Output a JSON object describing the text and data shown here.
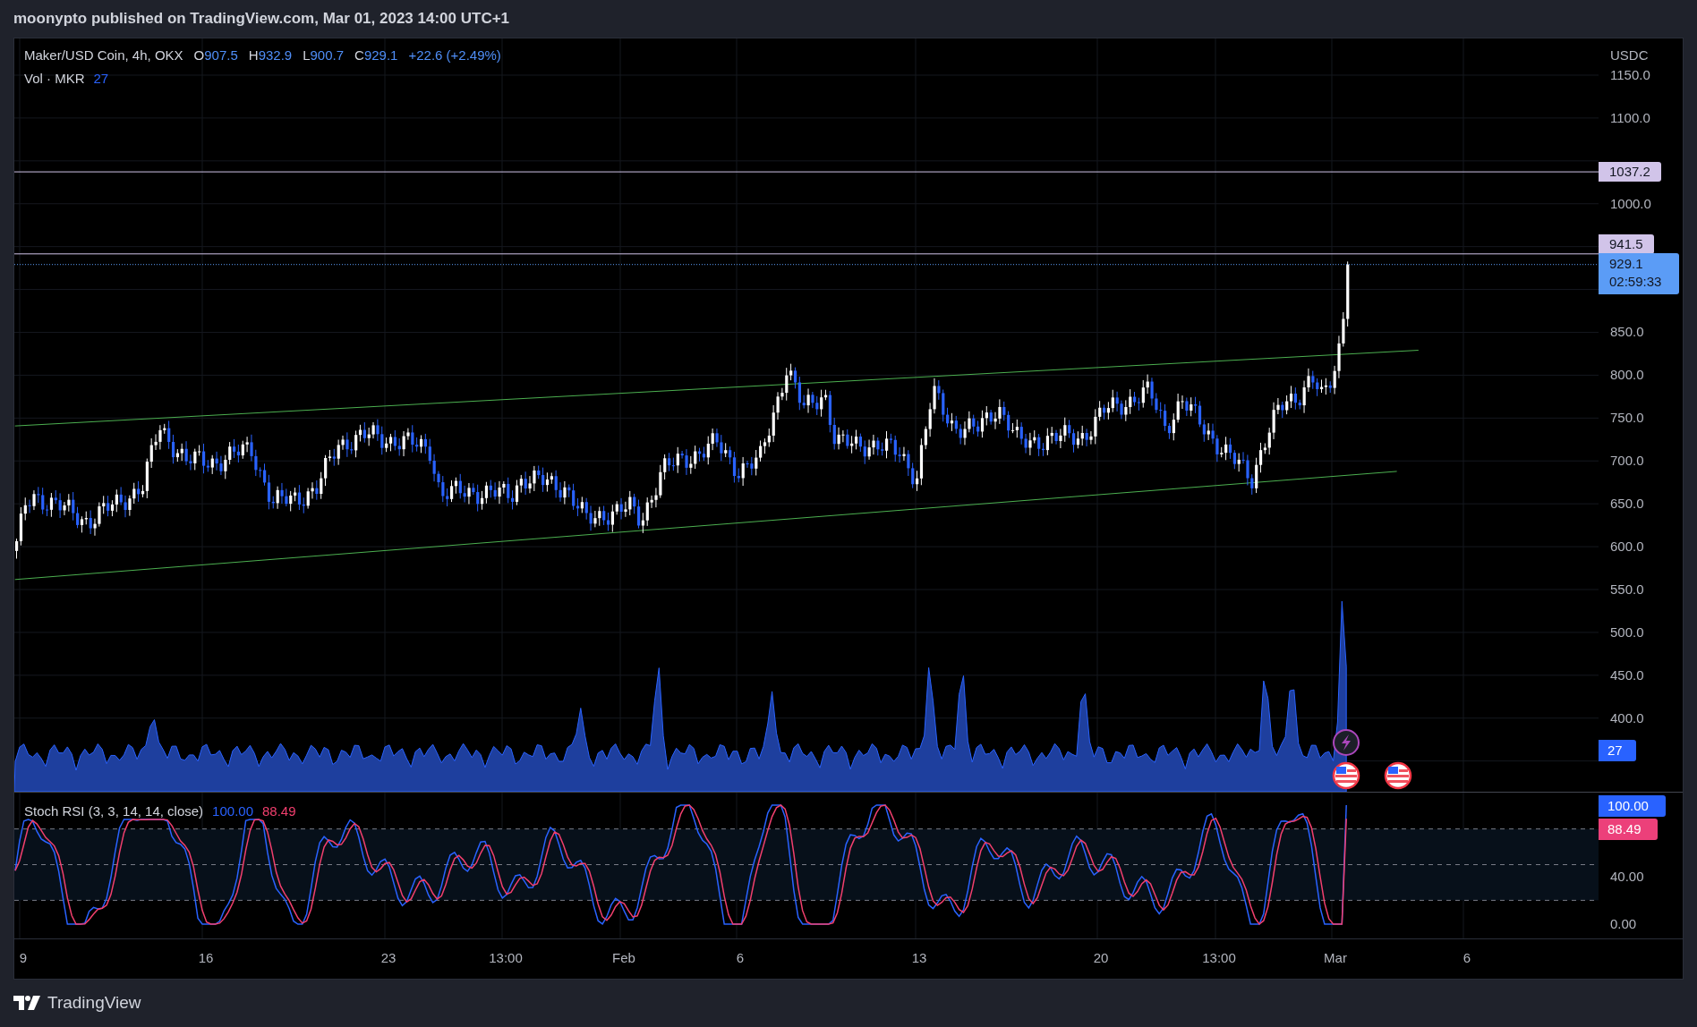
{
  "header": {
    "text": "moonypto published on TradingView.com, Mar 01, 2023 14:00 UTC+1"
  },
  "legend": {
    "symbol": "Maker/USD Coin, 4h, OKX",
    "ohlc": [
      {
        "label": "O",
        "value": "907.5"
      },
      {
        "label": "H",
        "value": "932.9"
      },
      {
        "label": "L",
        "value": "900.7"
      },
      {
        "label": "C",
        "value": "929.1"
      }
    ],
    "change": "+22.6 (+2.49%)"
  },
  "volume_legend": {
    "label": "Vol · MKR",
    "value": "27"
  },
  "price_axis": {
    "unit": "USDC",
    "ticks": [
      "1150.0",
      "1100.0",
      "1000.0",
      "850.0",
      "800.0",
      "750.0",
      "700.0",
      "650.0",
      "600.0",
      "550.0",
      "500.0",
      "450.0",
      "400.0"
    ]
  },
  "price_labels": [
    {
      "kind": "level",
      "text": "1037.2"
    },
    {
      "kind": "level",
      "text": "941.5"
    },
    {
      "kind": "last",
      "text": "929.1",
      "countdown": "02:59:33"
    },
    {
      "kind": "volume",
      "text": "27"
    }
  ],
  "stoch": {
    "label": "Stoch RSI (3, 3, 14, 14, close)",
    "k": "100.00",
    "d": "88.49",
    "axis_ticks": [
      "40.00",
      "0.00"
    ],
    "badges": [
      {
        "kind": "k",
        "text": "100.00"
      },
      {
        "kind": "d",
        "text": "88.49"
      }
    ]
  },
  "time_axis": [
    "9",
    "16",
    "23",
    "13:00",
    "Feb",
    "6",
    "13",
    "20",
    "13:00",
    "Mar",
    "6"
  ],
  "footer": {
    "brand": "TradingView"
  }
}
